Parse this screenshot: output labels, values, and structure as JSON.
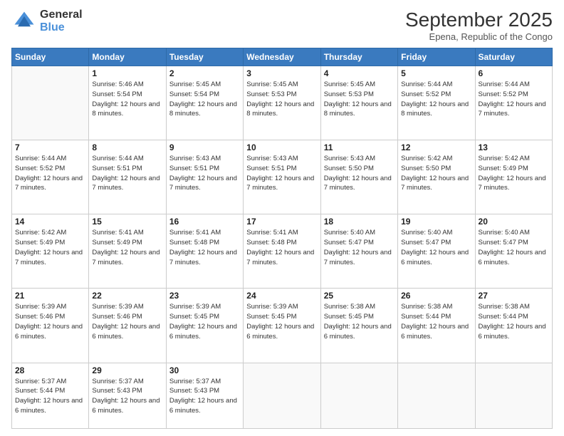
{
  "logo": {
    "general": "General",
    "blue": "Blue"
  },
  "header": {
    "title": "September 2025",
    "subtitle": "Epena, Republic of the Congo"
  },
  "weekdays": [
    "Sunday",
    "Monday",
    "Tuesday",
    "Wednesday",
    "Thursday",
    "Friday",
    "Saturday"
  ],
  "weeks": [
    [
      {
        "day": "",
        "info": ""
      },
      {
        "day": "1",
        "info": "Sunrise: 5:46 AM\nSunset: 5:54 PM\nDaylight: 12 hours\nand 8 minutes."
      },
      {
        "day": "2",
        "info": "Sunrise: 5:45 AM\nSunset: 5:54 PM\nDaylight: 12 hours\nand 8 minutes."
      },
      {
        "day": "3",
        "info": "Sunrise: 5:45 AM\nSunset: 5:53 PM\nDaylight: 12 hours\nand 8 minutes."
      },
      {
        "day": "4",
        "info": "Sunrise: 5:45 AM\nSunset: 5:53 PM\nDaylight: 12 hours\nand 8 minutes."
      },
      {
        "day": "5",
        "info": "Sunrise: 5:44 AM\nSunset: 5:52 PM\nDaylight: 12 hours\nand 8 minutes."
      },
      {
        "day": "6",
        "info": "Sunrise: 5:44 AM\nSunset: 5:52 PM\nDaylight: 12 hours\nand 7 minutes."
      }
    ],
    [
      {
        "day": "7",
        "info": "Sunrise: 5:44 AM\nSunset: 5:52 PM\nDaylight: 12 hours\nand 7 minutes."
      },
      {
        "day": "8",
        "info": "Sunrise: 5:44 AM\nSunset: 5:51 PM\nDaylight: 12 hours\nand 7 minutes."
      },
      {
        "day": "9",
        "info": "Sunrise: 5:43 AM\nSunset: 5:51 PM\nDaylight: 12 hours\nand 7 minutes."
      },
      {
        "day": "10",
        "info": "Sunrise: 5:43 AM\nSunset: 5:51 PM\nDaylight: 12 hours\nand 7 minutes."
      },
      {
        "day": "11",
        "info": "Sunrise: 5:43 AM\nSunset: 5:50 PM\nDaylight: 12 hours\nand 7 minutes."
      },
      {
        "day": "12",
        "info": "Sunrise: 5:42 AM\nSunset: 5:50 PM\nDaylight: 12 hours\nand 7 minutes."
      },
      {
        "day": "13",
        "info": "Sunrise: 5:42 AM\nSunset: 5:49 PM\nDaylight: 12 hours\nand 7 minutes."
      }
    ],
    [
      {
        "day": "14",
        "info": "Sunrise: 5:42 AM\nSunset: 5:49 PM\nDaylight: 12 hours\nand 7 minutes."
      },
      {
        "day": "15",
        "info": "Sunrise: 5:41 AM\nSunset: 5:49 PM\nDaylight: 12 hours\nand 7 minutes."
      },
      {
        "day": "16",
        "info": "Sunrise: 5:41 AM\nSunset: 5:48 PM\nDaylight: 12 hours\nand 7 minutes."
      },
      {
        "day": "17",
        "info": "Sunrise: 5:41 AM\nSunset: 5:48 PM\nDaylight: 12 hours\nand 7 minutes."
      },
      {
        "day": "18",
        "info": "Sunrise: 5:40 AM\nSunset: 5:47 PM\nDaylight: 12 hours\nand 7 minutes."
      },
      {
        "day": "19",
        "info": "Sunrise: 5:40 AM\nSunset: 5:47 PM\nDaylight: 12 hours\nand 6 minutes."
      },
      {
        "day": "20",
        "info": "Sunrise: 5:40 AM\nSunset: 5:47 PM\nDaylight: 12 hours\nand 6 minutes."
      }
    ],
    [
      {
        "day": "21",
        "info": "Sunrise: 5:39 AM\nSunset: 5:46 PM\nDaylight: 12 hours\nand 6 minutes."
      },
      {
        "day": "22",
        "info": "Sunrise: 5:39 AM\nSunset: 5:46 PM\nDaylight: 12 hours\nand 6 minutes."
      },
      {
        "day": "23",
        "info": "Sunrise: 5:39 AM\nSunset: 5:45 PM\nDaylight: 12 hours\nand 6 minutes."
      },
      {
        "day": "24",
        "info": "Sunrise: 5:39 AM\nSunset: 5:45 PM\nDaylight: 12 hours\nand 6 minutes."
      },
      {
        "day": "25",
        "info": "Sunrise: 5:38 AM\nSunset: 5:45 PM\nDaylight: 12 hours\nand 6 minutes."
      },
      {
        "day": "26",
        "info": "Sunrise: 5:38 AM\nSunset: 5:44 PM\nDaylight: 12 hours\nand 6 minutes."
      },
      {
        "day": "27",
        "info": "Sunrise: 5:38 AM\nSunset: 5:44 PM\nDaylight: 12 hours\nand 6 minutes."
      }
    ],
    [
      {
        "day": "28",
        "info": "Sunrise: 5:37 AM\nSunset: 5:44 PM\nDaylight: 12 hours\nand 6 minutes."
      },
      {
        "day": "29",
        "info": "Sunrise: 5:37 AM\nSunset: 5:43 PM\nDaylight: 12 hours\nand 6 minutes."
      },
      {
        "day": "30",
        "info": "Sunrise: 5:37 AM\nSunset: 5:43 PM\nDaylight: 12 hours\nand 6 minutes."
      },
      {
        "day": "",
        "info": ""
      },
      {
        "day": "",
        "info": ""
      },
      {
        "day": "",
        "info": ""
      },
      {
        "day": "",
        "info": ""
      }
    ]
  ]
}
